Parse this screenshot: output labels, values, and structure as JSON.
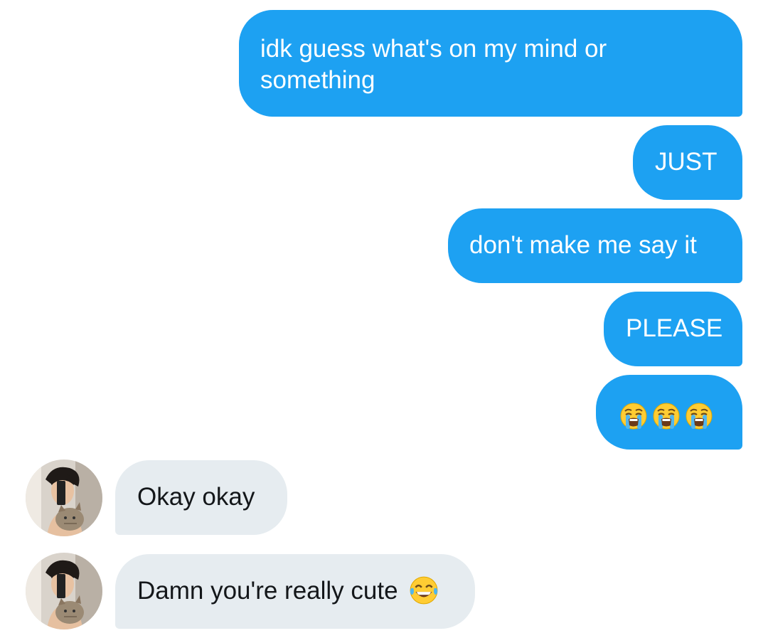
{
  "colors": {
    "sent_bubble": "#1da1f2",
    "received_bubble": "#e6ecf0",
    "sent_text": "#ffffff",
    "received_text": "#14171a"
  },
  "messages": [
    {
      "direction": "sent",
      "text": "idk guess what's on my mind or something"
    },
    {
      "direction": "sent",
      "text": "JUST"
    },
    {
      "direction": "sent",
      "text": "don't make me say it"
    },
    {
      "direction": "sent",
      "text": "PLEASE"
    },
    {
      "direction": "sent",
      "text": "",
      "emoji": [
        "loudly-crying-face-icon",
        "loudly-crying-face-icon",
        "loudly-crying-face-icon"
      ]
    },
    {
      "direction": "received",
      "text": "Okay okay",
      "avatar": "sender-avatar"
    },
    {
      "direction": "received",
      "text": "Damn you're really cute",
      "emoji": [
        "face-with-tears-of-joy-icon"
      ],
      "avatar": "sender-avatar"
    }
  ]
}
